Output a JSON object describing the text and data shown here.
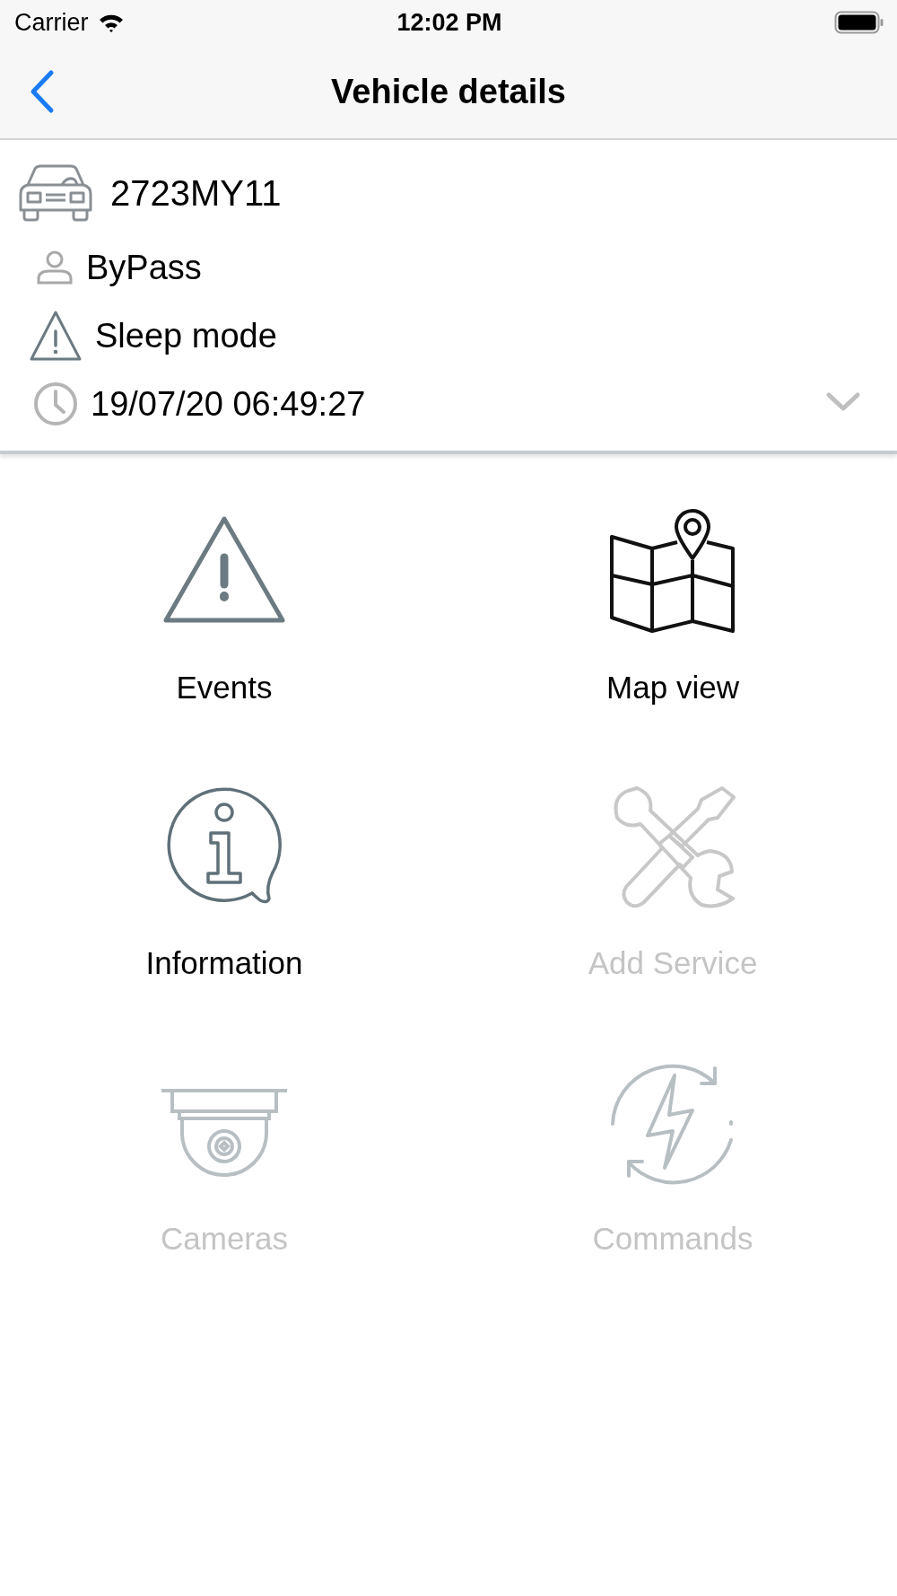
{
  "status_bar": {
    "carrier": "Carrier",
    "time": "12:02 PM"
  },
  "nav": {
    "title": "Vehicle details"
  },
  "vehicle": {
    "plate": "2723MY11",
    "driver": "ByPass",
    "state": "Sleep mode",
    "timestamp": "19/07/20 06:49:27",
    "expanded": false
  },
  "tiles": [
    {
      "label": "Events",
      "kind": "warning",
      "disabled": false
    },
    {
      "label": "Map view",
      "kind": "map",
      "disabled": false
    },
    {
      "label": "Information",
      "kind": "info",
      "disabled": false
    },
    {
      "label": "Add Service",
      "kind": "tools",
      "disabled": true
    },
    {
      "label": "Cameras",
      "kind": "camera",
      "disabled": true
    },
    {
      "label": "Commands",
      "kind": "commands",
      "disabled": true
    }
  ]
}
